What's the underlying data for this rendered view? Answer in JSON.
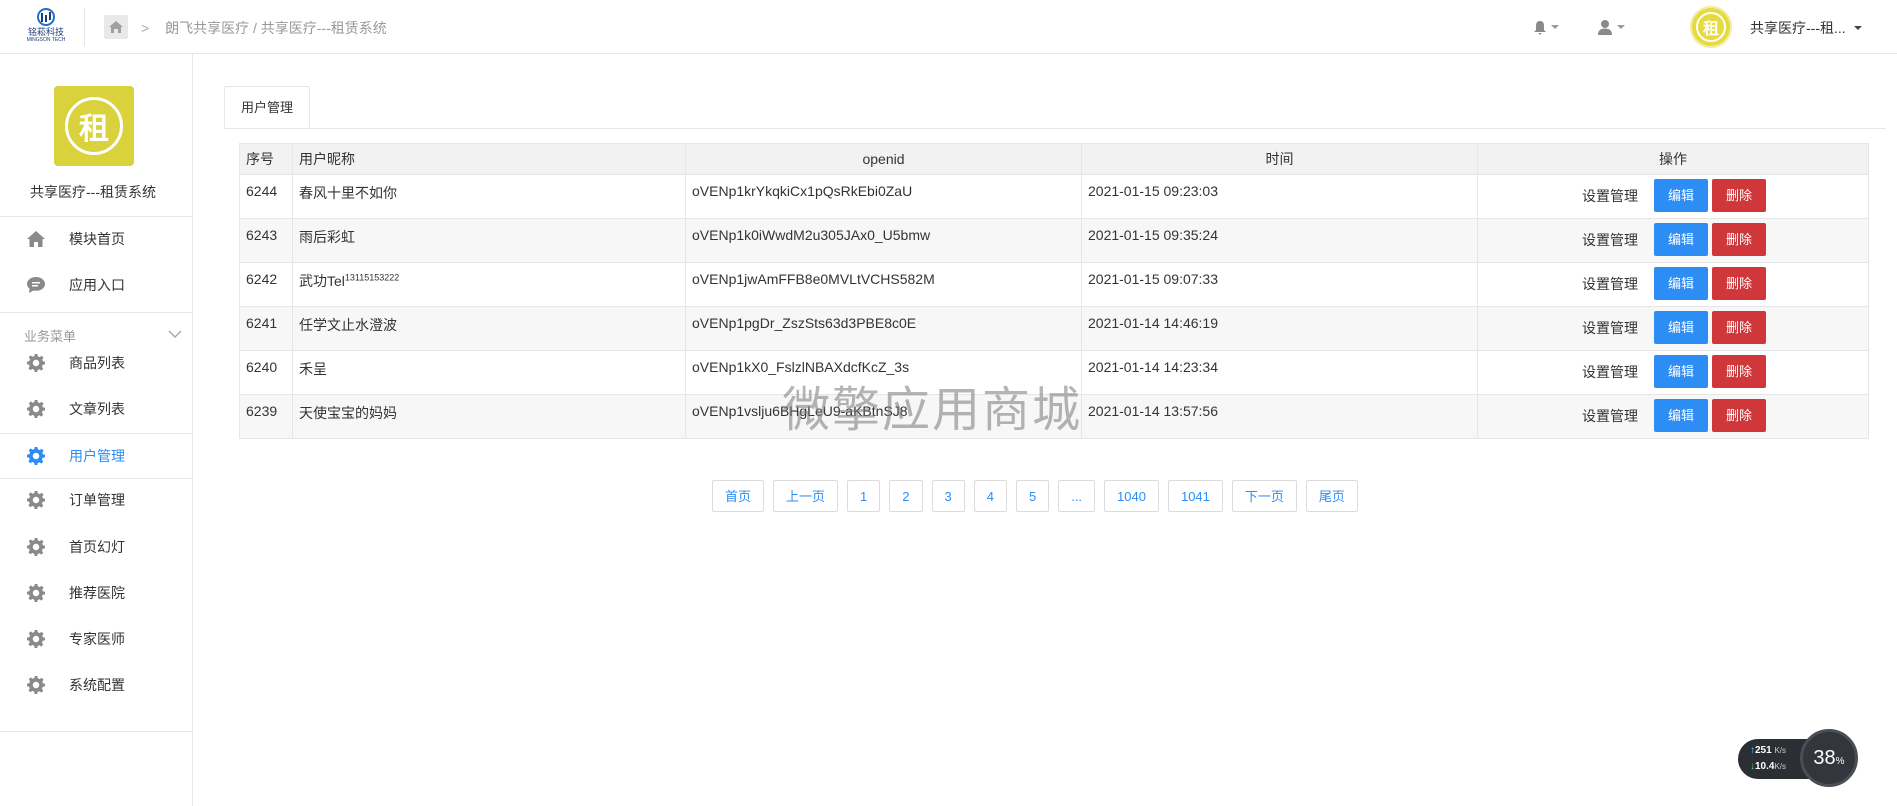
{
  "brand": {
    "name": "铭菘科技",
    "sub": "MINGSON TECH"
  },
  "breadcrumb": {
    "separator": ">",
    "path": "朗飞共享医疗 / 共享医疗---租赁系统"
  },
  "header": {
    "user_name": "共享医疗---租...",
    "avatar_char": "租"
  },
  "sidebar": {
    "logo_char": "租",
    "title": "共享医疗---租赁系统",
    "top_items": [
      {
        "label": "模块首页",
        "icon": "home-icon"
      },
      {
        "label": "应用入口",
        "icon": "chat-icon"
      }
    ],
    "group_label": "业务菜单",
    "items": [
      {
        "label": "商品列表",
        "icon": "gear-icon"
      },
      {
        "label": "文章列表",
        "icon": "gear-icon"
      },
      {
        "label": "用户管理",
        "icon": "gear-icon",
        "active": true
      },
      {
        "label": "订单管理",
        "icon": "gear-icon"
      },
      {
        "label": "首页幻灯",
        "icon": "gear-icon"
      },
      {
        "label": "推荐医院",
        "icon": "gear-icon"
      },
      {
        "label": "专家医师",
        "icon": "gear-icon"
      },
      {
        "label": "系统配置",
        "icon": "gear-icon"
      }
    ]
  },
  "tab": {
    "label": "用户管理"
  },
  "table": {
    "headers": {
      "id": "序号",
      "nickname": "用户昵称",
      "openid": "openid",
      "time": "时间",
      "ops": "操作"
    },
    "op_labels": {
      "settings": "设置管理",
      "edit": "编辑",
      "delete": "删除"
    },
    "rows": [
      {
        "id": "6244",
        "nickname": "春风十里不如你",
        "nickname_sup": "",
        "openid": "oVENp1krYkqkiCx1pQsRkEbi0ZaU",
        "time": "2021-01-15 09:23:03"
      },
      {
        "id": "6243",
        "nickname": "雨后彩虹",
        "nickname_sup": "",
        "openid": "oVENp1k0iWwdM2u305JAx0_U5bmw",
        "time": "2021-01-15 09:35:24"
      },
      {
        "id": "6242",
        "nickname": "武功Tel",
        "nickname_sup": "13115153222",
        "openid": "oVENp1jwAmFFB8e0MVLtVCHS582M",
        "time": "2021-01-15 09:07:33"
      },
      {
        "id": "6241",
        "nickname": "任学文止水澄波",
        "nickname_sup": "",
        "openid": "oVENp1pgDr_ZszSts63d3PBE8c0E",
        "time": "2021-01-14 14:46:19"
      },
      {
        "id": "6240",
        "nickname": "禾呈",
        "nickname_sup": "",
        "openid": "oVENp1kX0_FslzlNBAXdcfKcZ_3s",
        "time": "2021-01-14 14:23:34"
      },
      {
        "id": "6239",
        "nickname": "天使宝宝的妈妈",
        "nickname_sup": "",
        "openid": "oVENp1vslju6BHgLeU9-aKBtnSJ8",
        "time": "2021-01-14 13:57:56"
      }
    ]
  },
  "pagination": [
    "首页",
    "上一页",
    "1",
    "2",
    "3",
    "4",
    "5",
    "...",
    "1040",
    "1041",
    "下一页",
    "尾页"
  ],
  "watermark": "微擎应用商城",
  "net_monitor": {
    "up": "251",
    "down": "10.4",
    "unit": "K/s",
    "percent": "38",
    "percent_unit": "%"
  },
  "colors": {
    "accent": "#2c8df4",
    "danger": "#d0373a",
    "logo": "#d9d23c"
  }
}
